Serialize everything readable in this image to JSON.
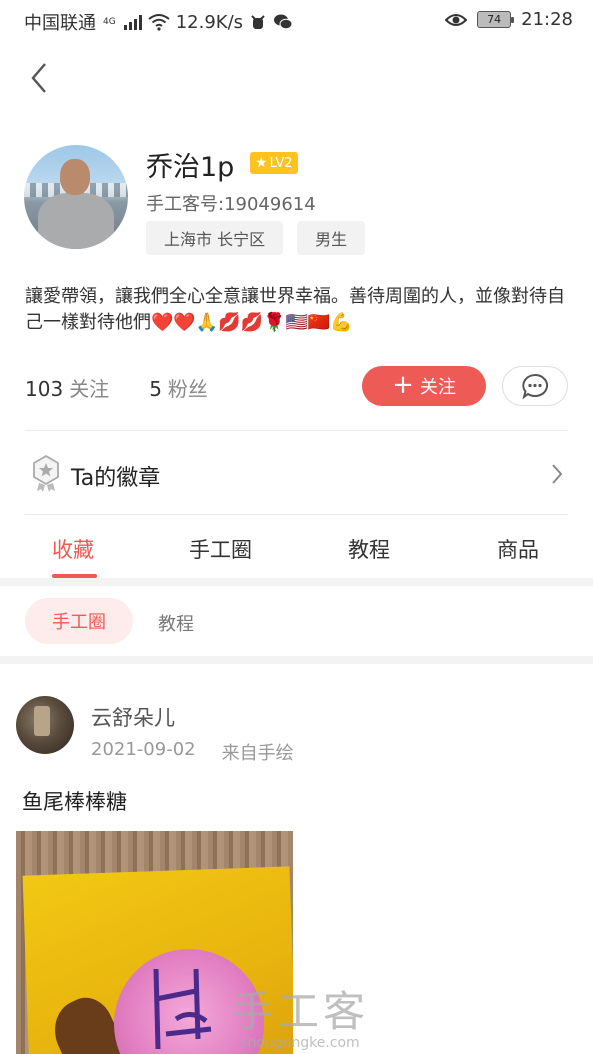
{
  "status_bar": {
    "carrier": "中国联通",
    "network": "4G",
    "speed": "12.9K/s",
    "battery": "74",
    "time": "21:28"
  },
  "profile": {
    "name": "乔治1p",
    "level": "LV2",
    "uid": "手工客号:19049614",
    "location": "上海市 长宁区",
    "gender": "男生",
    "bio": "讓愛帶領，讓我們全心全意讓世界幸福。善待周圍的人，並像對待自己一樣對待他們❤️❤️🙏💋💋🌹🇺🇸🇨🇳💪",
    "following_count": "103",
    "following_label": "关注",
    "fans_count": "5",
    "fans_label": "粉丝",
    "follow_button": "关注"
  },
  "badges": {
    "label": "Ta的徽章"
  },
  "tabs": [
    {
      "label": "收藏",
      "active": true
    },
    {
      "label": "手工圈",
      "active": false
    },
    {
      "label": "教程",
      "active": false
    },
    {
      "label": "商品",
      "active": false
    }
  ],
  "subtabs": [
    {
      "label": "手工圈",
      "active": true
    },
    {
      "label": "教程",
      "active": false
    }
  ],
  "post": {
    "user": "云舒朵儿",
    "date": "2021-09-02",
    "source": "来自手绘",
    "title": "鱼尾棒棒糖"
  },
  "watermark": {
    "main": "手工客",
    "sub": "shougongke.com"
  },
  "colors": {
    "accent": "#ee5a55",
    "level_badge": "#ffc21f"
  }
}
